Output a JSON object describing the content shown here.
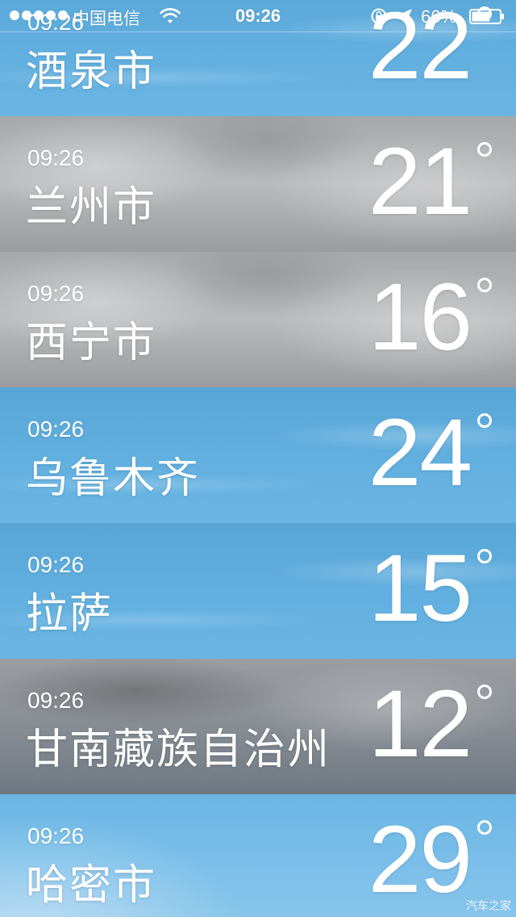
{
  "status_bar": {
    "carrier": "中国电信",
    "time": "09:26",
    "battery_percent": "66%",
    "battery_level": 0.66,
    "signal_dots": 5,
    "icons": [
      "signal-dots-icon",
      "wifi-icon",
      "rotation-lock-icon",
      "location-arrow-icon",
      "battery-icon"
    ]
  },
  "cities": [
    {
      "time": "09:26",
      "name": "酒泉市",
      "temp": "22",
      "bg": "blue"
    },
    {
      "time": "09:26",
      "name": "兰州市",
      "temp": "21",
      "bg": "gray"
    },
    {
      "time": "09:26",
      "name": "西宁市",
      "temp": "16",
      "bg": "gray"
    },
    {
      "time": "09:26",
      "name": "乌鲁木齐",
      "temp": "24",
      "bg": "blue"
    },
    {
      "time": "09:26",
      "name": "拉萨",
      "temp": "15",
      "bg": "blue"
    },
    {
      "time": "09:26",
      "name": "甘南藏族自治州",
      "temp": "12",
      "bg": "dark"
    },
    {
      "time": "09:26",
      "name": "哈密市",
      "temp": "29",
      "bg": "sunny"
    }
  ],
  "watermark": "汽车之家"
}
